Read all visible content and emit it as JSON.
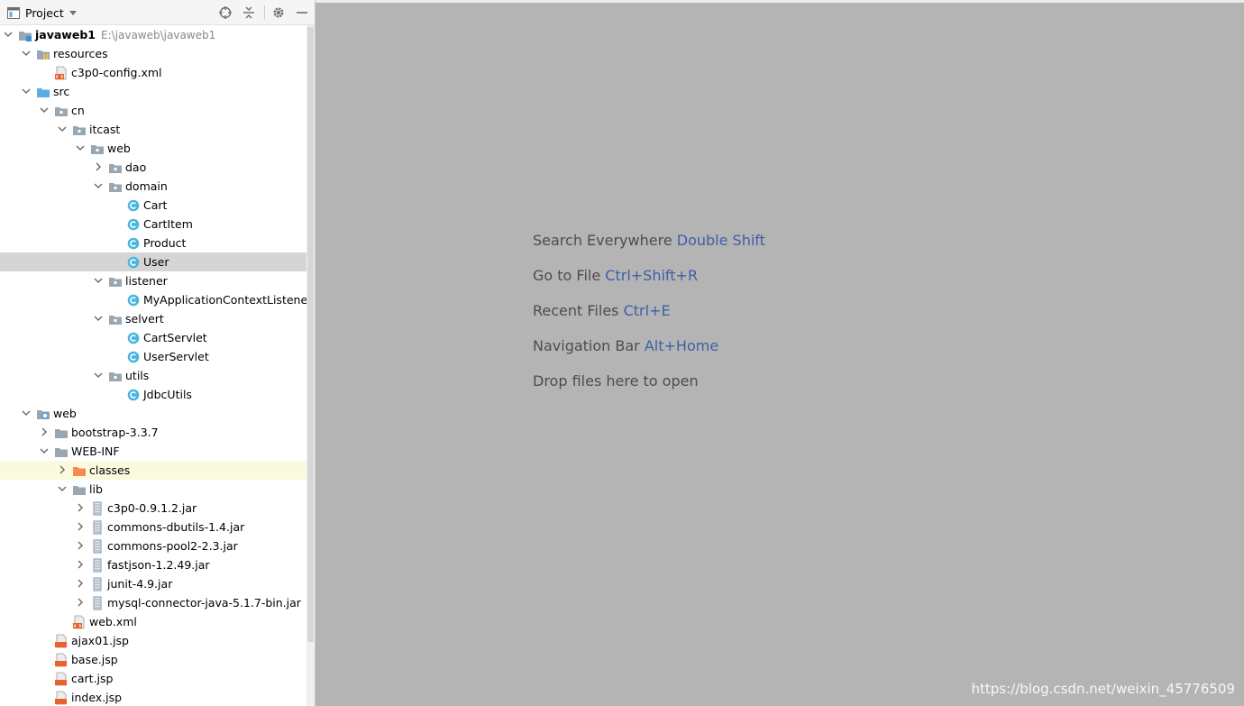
{
  "toolbar": {
    "title": "Project",
    "icons": [
      "locate-icon",
      "collapse-all-icon",
      "gear-icon",
      "minimize-icon"
    ]
  },
  "tree": [
    {
      "label": "javaweb1",
      "path": "E:\\javaweb\\javaweb1",
      "depth": 0,
      "expand": "open",
      "icon": "module-folder",
      "bold": true
    },
    {
      "label": "resources",
      "depth": 1,
      "expand": "open",
      "icon": "resources-folder"
    },
    {
      "label": "c3p0-config.xml",
      "depth": 2,
      "expand": "none",
      "icon": "xml-file"
    },
    {
      "label": "src",
      "depth": 1,
      "expand": "open",
      "icon": "source-folder"
    },
    {
      "label": "cn",
      "depth": 2,
      "expand": "open",
      "icon": "package"
    },
    {
      "label": "itcast",
      "depth": 3,
      "expand": "open",
      "icon": "package"
    },
    {
      "label": "web",
      "depth": 4,
      "expand": "open",
      "icon": "package"
    },
    {
      "label": "dao",
      "depth": 5,
      "expand": "closed",
      "icon": "package"
    },
    {
      "label": "domain",
      "depth": 5,
      "expand": "open",
      "icon": "package"
    },
    {
      "label": "Cart",
      "depth": 6,
      "expand": "none",
      "icon": "java-class"
    },
    {
      "label": "CartItem",
      "depth": 6,
      "expand": "none",
      "icon": "java-class"
    },
    {
      "label": "Product",
      "depth": 6,
      "expand": "none",
      "icon": "java-class"
    },
    {
      "label": "User",
      "depth": 6,
      "expand": "none",
      "icon": "java-class",
      "state": "selected"
    },
    {
      "label": "listener",
      "depth": 5,
      "expand": "open",
      "icon": "package"
    },
    {
      "label": "MyApplicationContextListener",
      "depth": 6,
      "expand": "none",
      "icon": "java-class"
    },
    {
      "label": "selvert",
      "depth": 5,
      "expand": "open",
      "icon": "package"
    },
    {
      "label": "CartServlet",
      "depth": 6,
      "expand": "none",
      "icon": "java-class"
    },
    {
      "label": "UserServlet",
      "depth": 6,
      "expand": "none",
      "icon": "java-class"
    },
    {
      "label": "utils",
      "depth": 5,
      "expand": "open",
      "icon": "package"
    },
    {
      "label": "JdbcUtils",
      "depth": 6,
      "expand": "none",
      "icon": "java-class"
    },
    {
      "label": "web",
      "depth": 1,
      "expand": "open",
      "icon": "web-folder"
    },
    {
      "label": "bootstrap-3.3.7",
      "depth": 2,
      "expand": "closed",
      "icon": "folder"
    },
    {
      "label": "WEB-INF",
      "depth": 2,
      "expand": "open",
      "icon": "folder"
    },
    {
      "label": "classes",
      "depth": 3,
      "expand": "closed",
      "icon": "excluded-folder",
      "state": "highlight"
    },
    {
      "label": "lib",
      "depth": 3,
      "expand": "open",
      "icon": "folder"
    },
    {
      "label": "c3p0-0.9.1.2.jar",
      "depth": 4,
      "expand": "closed",
      "icon": "jar"
    },
    {
      "label": "commons-dbutils-1.4.jar",
      "depth": 4,
      "expand": "closed",
      "icon": "jar"
    },
    {
      "label": "commons-pool2-2.3.jar",
      "depth": 4,
      "expand": "closed",
      "icon": "jar"
    },
    {
      "label": "fastjson-1.2.49.jar",
      "depth": 4,
      "expand": "closed",
      "icon": "jar"
    },
    {
      "label": "junit-4.9.jar",
      "depth": 4,
      "expand": "closed",
      "icon": "jar"
    },
    {
      "label": "mysql-connector-java-5.1.7-bin.jar",
      "depth": 4,
      "expand": "closed",
      "icon": "jar"
    },
    {
      "label": "web.xml",
      "depth": 3,
      "expand": "none",
      "icon": "xml-file"
    },
    {
      "label": "ajax01.jsp",
      "depth": 2,
      "expand": "none",
      "icon": "jsp-file"
    },
    {
      "label": "base.jsp",
      "depth": 2,
      "expand": "none",
      "icon": "jsp-file"
    },
    {
      "label": "cart.jsp",
      "depth": 2,
      "expand": "none",
      "icon": "jsp-file"
    },
    {
      "label": "index.jsp",
      "depth": 2,
      "expand": "none",
      "icon": "jsp-file"
    }
  ],
  "editor": {
    "hints": [
      {
        "text": "Search Everywhere",
        "key": "Double Shift"
      },
      {
        "text": "Go to File",
        "key": "Ctrl+Shift+R"
      },
      {
        "text": "Recent Files",
        "key": "Ctrl+E"
      },
      {
        "text": "Navigation Bar",
        "key": "Alt+Home"
      },
      {
        "text": "Drop files here to open",
        "key": ""
      }
    ]
  },
  "watermark": "https://blog.csdn.net/weixin_45776509",
  "colors": {
    "editor_bg": "#b4b4b4",
    "shortcut_key": "#3f5fa6",
    "selected_row": "#d5d5d5",
    "highlight_row": "#fbfadf",
    "class_icon": "#49b6e0",
    "folder": "#9aa7b0",
    "source_folder": "#5aaee0",
    "excluded_folder": "#f28c4f"
  }
}
